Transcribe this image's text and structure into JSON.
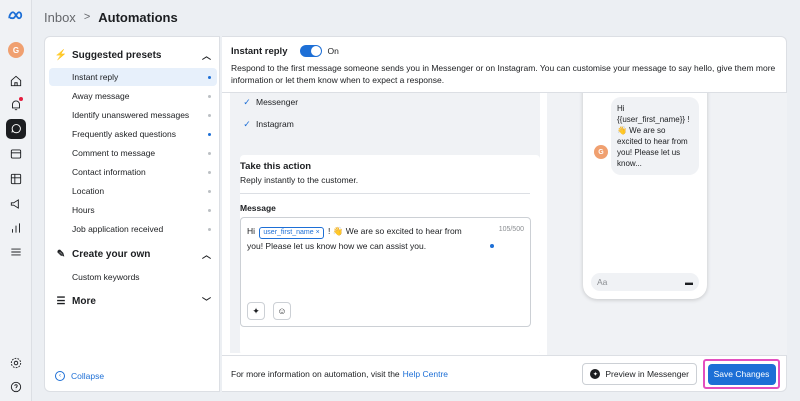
{
  "app": {
    "avatar_letter": "G"
  },
  "breadcrumb": {
    "parent": "Inbox",
    "separator": ">",
    "current": "Automations"
  },
  "sidebar": {
    "presets_title": "Suggested presets",
    "items": [
      {
        "label": "Instant reply",
        "active": true,
        "dot": "blue"
      },
      {
        "label": "Away message",
        "dot": "grey"
      },
      {
        "label": "Identify unanswered messages",
        "dot": "grey"
      },
      {
        "label": "Frequently asked questions",
        "dot": "blue"
      },
      {
        "label": "Comment to message",
        "dot": "grey"
      },
      {
        "label": "Contact information",
        "dot": "grey"
      },
      {
        "label": "Location",
        "dot": "grey"
      },
      {
        "label": "Hours",
        "dot": "grey"
      },
      {
        "label": "Job application received",
        "dot": "grey"
      }
    ],
    "create_title": "Create your own",
    "custom_keywords": "Custom keywords",
    "more_title": "More",
    "collapse": "Collapse"
  },
  "instant_reply": {
    "title": "Instant reply",
    "toggle_state": "On",
    "description": "Respond to the first message someone sends you in Messenger or on Instagram. You can customise your message to say hello, give them more information or let them know when to expect a response."
  },
  "editor": {
    "channels": [
      "Messenger",
      "Instagram"
    ],
    "action_title": "Take this action",
    "action_sub": "Reply instantly to the customer.",
    "message_label": "Message",
    "message_prefix": "Hi",
    "message_chip": "user_first_name",
    "message_chip_close": "×",
    "message_body": "! 👋 We are so excited to hear from you! Please let us know how we can assist you.",
    "char_count": "105/500"
  },
  "preview": {
    "bubble_text": "Hi {{user_first_name}} ! 👋 We are so excited to hear from you! Please let us know...",
    "avatar_letter": "G",
    "compose_placeholder": "Aa"
  },
  "footer": {
    "info_text": "For more information on automation, visit the",
    "help_link": "Help Centre",
    "preview_button": "Preview in Messenger",
    "save_button": "Save Changes"
  },
  "colors": {
    "accent": "#1d6fd6",
    "highlight": "#e34fbf",
    "active_bg": "#e7f0fb"
  }
}
